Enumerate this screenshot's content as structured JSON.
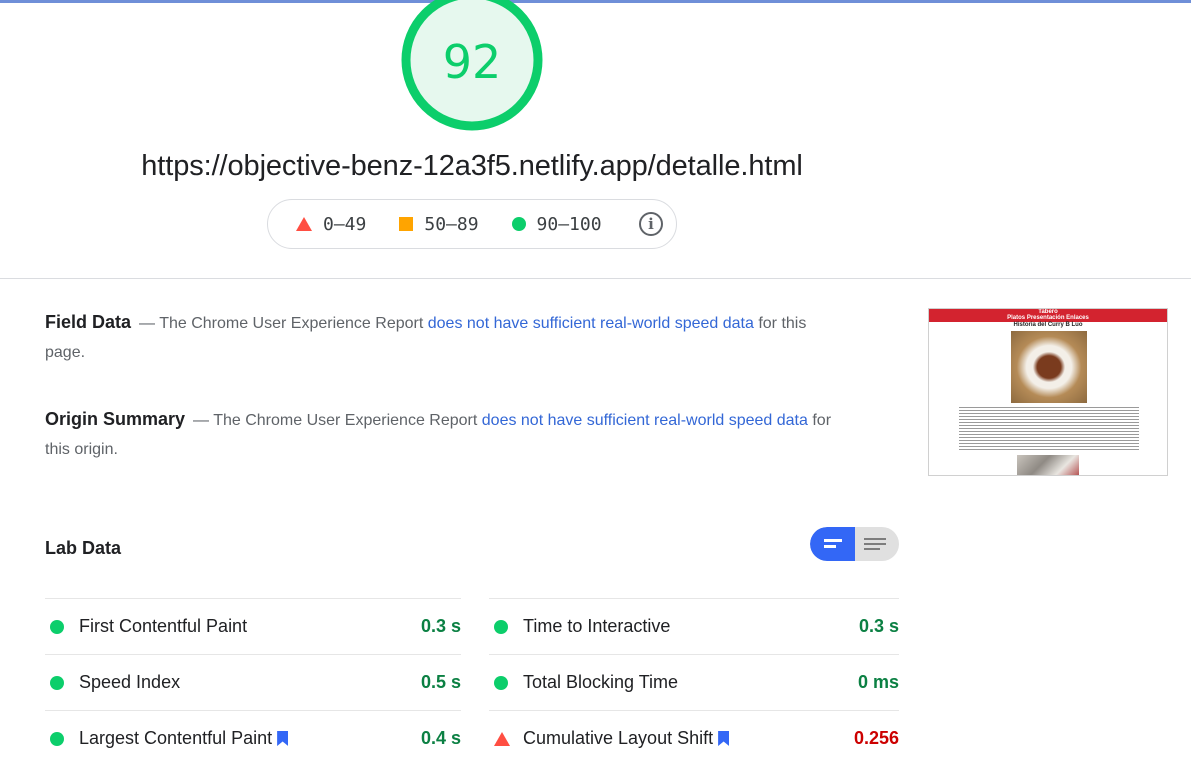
{
  "score": {
    "value": "92",
    "fraction": 0.92,
    "color": "#0cce6b"
  },
  "report_url": "https://objective-benz-12a3f5.netlify.app/detalle.html",
  "legend": {
    "items": [
      {
        "icon": "red-triangle-icon",
        "label": "0–49",
        "color": "#ff4e42"
      },
      {
        "icon": "orange-square-icon",
        "label": "50–89",
        "color": "#ffa400"
      },
      {
        "icon": "green-circle-icon",
        "label": "90–100",
        "color": "#0cce6b"
      }
    ],
    "info_icon": "info-icon"
  },
  "field_data": {
    "title": "Field Data",
    "pre": "— The Chrome User Experience Report ",
    "link": "does not have sufficient real-world speed data",
    "post": " for this page."
  },
  "origin_summary": {
    "title": "Origin Summary",
    "pre": "— The Chrome User Experience Report ",
    "link": "does not have sufficient real-world speed data",
    "post": " for this origin."
  },
  "thumbnail": {
    "header_line1": "Tabero",
    "header_line2": "Platos  Presentación  Enlaces",
    "heading": "Historia del Curry B Luo"
  },
  "lab_data": {
    "title": "Lab Data",
    "toggle_icons": [
      "compact-view-icon",
      "list-view-icon"
    ],
    "metrics_left": [
      {
        "name": "First Contentful Paint",
        "value": "0.3 s",
        "status": "pass",
        "bookmark": false
      },
      {
        "name": "Speed Index",
        "value": "0.5 s",
        "status": "pass",
        "bookmark": false
      },
      {
        "name": "Largest Contentful Paint",
        "value": "0.4 s",
        "status": "pass",
        "bookmark": true
      }
    ],
    "metrics_right": [
      {
        "name": "Time to Interactive",
        "value": "0.3 s",
        "status": "pass",
        "bookmark": false
      },
      {
        "name": "Total Blocking Time",
        "value": "0 ms",
        "status": "pass",
        "bookmark": false
      },
      {
        "name": "Cumulative Layout Shift",
        "value": "0.256",
        "status": "fail",
        "bookmark": true
      }
    ]
  },
  "colors": {
    "pass": "#0cce6b",
    "pass_text": "#0b8043",
    "fail": "#ff4e42",
    "fail_text": "#cc0000",
    "link": "#3367d6",
    "accent": "#3367f6"
  }
}
